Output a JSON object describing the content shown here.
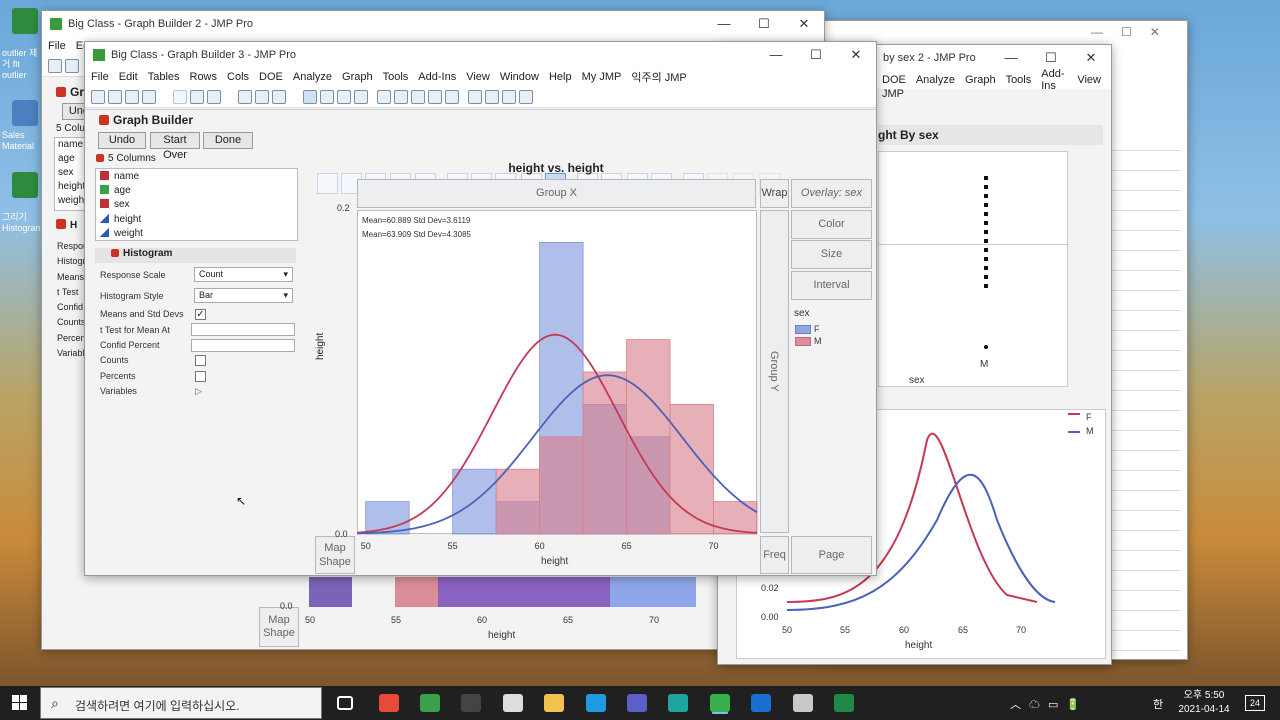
{
  "desktop": {
    "icons": [
      "outlier 제거 fit outlier",
      "Sales Material",
      "그리기 Histogram"
    ]
  },
  "back_window": {
    "title": "Big Class - Graph Builder 2 - JMP Pro",
    "menu_file": "File",
    "menu_edit": "Edit",
    "panel_title": "Graph Builder",
    "undo": "Undo",
    "columns": "5 Columns",
    "cols": [
      "name",
      "age",
      "sex",
      "height",
      "weight"
    ],
    "side": [
      "Response Scale",
      "Histogram Style",
      "Means",
      "t Test",
      "Confid",
      "Counts",
      "Percents",
      "Variables"
    ],
    "histogram_label": "H",
    "map_shape_1": "Map",
    "map_shape_2": "Shape",
    "y_zero": "0.0",
    "xlabel": "height",
    "xticks": [
      "50",
      "55",
      "60",
      "65",
      "70"
    ]
  },
  "right_window": {
    "title": "by sex 2 - JMP Pro",
    "menu": [
      "DOE",
      "Analyze",
      "Graph",
      "Tools",
      "Add-Ins",
      "View"
    ],
    "menu2": "JMP",
    "panel_title": "ght By sex",
    "x_cat": "M",
    "xlabel": "sex",
    "legend": [
      "F",
      "M"
    ],
    "yticks": [
      "0.02",
      "0.00"
    ],
    "xticks": [
      "50",
      "55",
      "60",
      "65",
      "70"
    ],
    "xlabel2": "height"
  },
  "back_window_1": {
    "title": "",
    "ctl": [
      "—",
      "☐",
      "✕"
    ]
  },
  "main_window": {
    "title": "Big Class - Graph Builder 3 - JMP Pro",
    "controls": [
      "—",
      "☐",
      "✕"
    ],
    "menu": [
      "File",
      "Edit",
      "Tables",
      "Rows",
      "Cols",
      "DOE",
      "Analyze",
      "Graph",
      "Tools",
      "Add-Ins",
      "View",
      "Window",
      "Help",
      "My JMP",
      "익주의 JMP"
    ],
    "panel_title": "Graph Builder",
    "buttons": {
      "undo": "Undo",
      "start_over": "Start Over",
      "done": "Done"
    },
    "columns_header": "5 Columns",
    "columns": [
      {
        "name": "name",
        "type": "nominal"
      },
      {
        "name": "age",
        "type": "ordinal"
      },
      {
        "name": "sex",
        "type": "nominal"
      },
      {
        "name": "height",
        "type": "continuous"
      },
      {
        "name": "weight",
        "type": "continuous"
      }
    ],
    "histogram_panel": {
      "title": "Histogram",
      "response_scale_label": "Response Scale",
      "response_scale_value": "Count",
      "histogram_style_label": "Histogram Style",
      "histogram_style_value": "Bar",
      "means_label": "Means and Std Devs",
      "means_checked": true,
      "ttest_label": "t Test for Mean At",
      "confid_label": "Confid Percent",
      "counts_label": "Counts",
      "percents_label": "Percents",
      "variables_label": "Variables"
    },
    "zones": {
      "group_x": "Group X",
      "wrap": "Wrap",
      "overlay": "Overlay: sex",
      "color": "Color",
      "size": "Size",
      "interval": "Interval",
      "group_y": "Group Y",
      "freq": "Freq",
      "page": "Page",
      "map_1": "Map",
      "map_2": "Shape"
    },
    "legend_title": "sex",
    "legend_items": [
      {
        "label": "F",
        "color": "#8fa6e0"
      },
      {
        "label": "M",
        "color": "#dc8e98"
      }
    ]
  },
  "chart_data": {
    "type": "bar",
    "title": "height vs. height",
    "xlabel": "height",
    "ylabel": "height",
    "xlim": [
      49.5,
      72.5
    ],
    "ylim": [
      0,
      0.2
    ],
    "yticks": [
      "0.2",
      "0.0"
    ],
    "xticks": [
      "50",
      "55",
      "60",
      "65",
      "70"
    ],
    "annotations": [
      "Mean=60.889   Std Dev=3.6119",
      "Mean=63.909   Std Dev=4.3085"
    ],
    "bin_edges": [
      50,
      52.5,
      55,
      57.5,
      60,
      62.5,
      65,
      67.5,
      70,
      72.5
    ],
    "series": [
      {
        "name": "F",
        "color": "#7f97dc",
        "values": [
          0.02,
          0,
          0.04,
          0.02,
          0.18,
          0.08,
          0.06,
          0,
          0
        ]
      },
      {
        "name": "M",
        "color": "#d97f8c",
        "values": [
          0,
          0,
          0,
          0.04,
          0.06,
          0.1,
          0.12,
          0.08,
          0.02
        ]
      }
    ],
    "density_curves": [
      {
        "name": "F",
        "color": "#c43a54",
        "mean": 60.889,
        "sd": 3.6119,
        "peak": 0.123
      },
      {
        "name": "M",
        "color": "#4a62b8",
        "mean": 63.909,
        "sd": 4.3085,
        "peak": 0.098
      }
    ]
  },
  "taskbar": {
    "search_placeholder": "검색하려면 여기에 입력하십시오.",
    "time": "오후 5:50",
    "date": "2021-04-14",
    "ime": "한",
    "notif": "24",
    "apps": [
      {
        "name": "task-view",
        "color": "#ffffff"
      },
      {
        "name": "chrome",
        "color": "#e84a3a"
      },
      {
        "name": "globe",
        "color": "#3aa04a"
      },
      {
        "name": "obs",
        "color": "#444444"
      },
      {
        "name": "doc",
        "color": "#dddddd"
      },
      {
        "name": "folder",
        "color": "#f2c14e"
      },
      {
        "name": "skype",
        "color": "#1e9ae0"
      },
      {
        "name": "teams",
        "color": "#5b5fc7"
      },
      {
        "name": "edge",
        "color": "#1fa5a0"
      },
      {
        "name": "jmp",
        "color": "#3ab04a"
      },
      {
        "name": "outlook",
        "color": "#1a6fd4"
      },
      {
        "name": "paint",
        "color": "#c8c8c8"
      },
      {
        "name": "excel",
        "color": "#1f8a48"
      }
    ]
  }
}
